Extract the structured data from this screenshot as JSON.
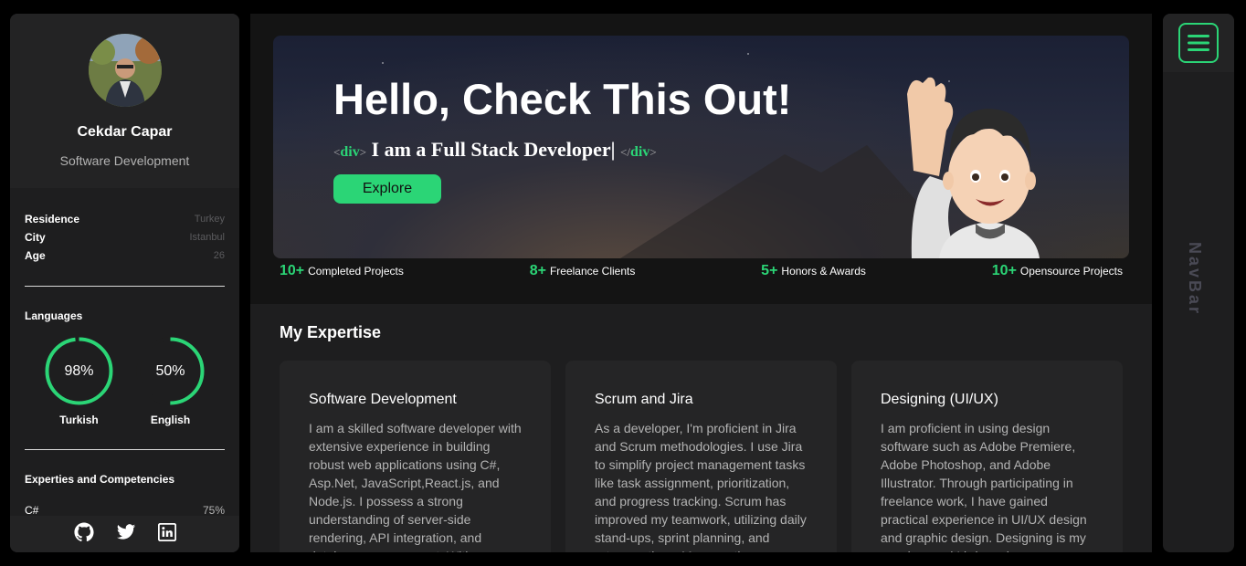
{
  "profile": {
    "name": "Cekdar Capar",
    "role": "Software Development",
    "info": [
      {
        "key": "Residence",
        "value": "Turkey"
      },
      {
        "key": "City",
        "value": "Istanbul"
      },
      {
        "key": "Age",
        "value": "26"
      }
    ],
    "languages_title": "Languages",
    "languages": [
      {
        "name": "Turkish",
        "percent_label": "98%",
        "level": 0.98
      },
      {
        "name": "English",
        "percent_label": "50%",
        "level": 0.5
      }
    ],
    "skills_title": "Experties and Competencies",
    "skills": [
      {
        "name": "C#",
        "value": "75%"
      }
    ],
    "socials": [
      "github-icon",
      "twitter-icon",
      "linkedin-icon"
    ]
  },
  "hero": {
    "title": "Hello, Check This Out!",
    "tag_open_left": "<",
    "tag_open_name": "div",
    "tag_open_right": ">",
    "subtitle": "I am a Full Stack Developer|",
    "tag_close_left": "</",
    "tag_close_name": "div",
    "tag_close_right": ">",
    "button": "Explore"
  },
  "stats": [
    {
      "value": "10+",
      "label": "Completed Projects"
    },
    {
      "value": "8+",
      "label": "Freelance Clients"
    },
    {
      "value": "5+",
      "label": "Honors & Awards"
    },
    {
      "value": "10+",
      "label": "Opensource Projects"
    }
  ],
  "expertise": {
    "title": "My Expertise",
    "cards": [
      {
        "title": "Software Development",
        "text": "I am a skilled software developer with extensive experience in building robust web applications using C#, Asp.Net, JavaScript,React.js, and Node.js. I possess a strong understanding of server-side rendering, API integration, and database management. With"
      },
      {
        "title": "Scrum and Jira",
        "text": "As a developer, I'm proficient in Jira and Scrum methodologies. I use Jira to simplify project management tasks like task assignment, prioritization, and progress tracking. Scrum has improved my teamwork, utilizing daily stand-ups, sprint planning, and retrospectives. My expertise"
      },
      {
        "title": "Designing (UI/UX)",
        "text": "I am proficient in using design software such as Adobe Premiere, Adobe Photoshop, and Adobe Illustrator. Through participating in freelance work, I have gained practical experience in UI/UX design and graphic design. Designing is my passion, and I bring a keen eye"
      }
    ]
  },
  "nav": {
    "label": "NavBar",
    "menu_icon": "hamburger-icon"
  },
  "colors": {
    "accent": "#2bd576",
    "panel": "#1e1e1f",
    "background": "#000000"
  }
}
